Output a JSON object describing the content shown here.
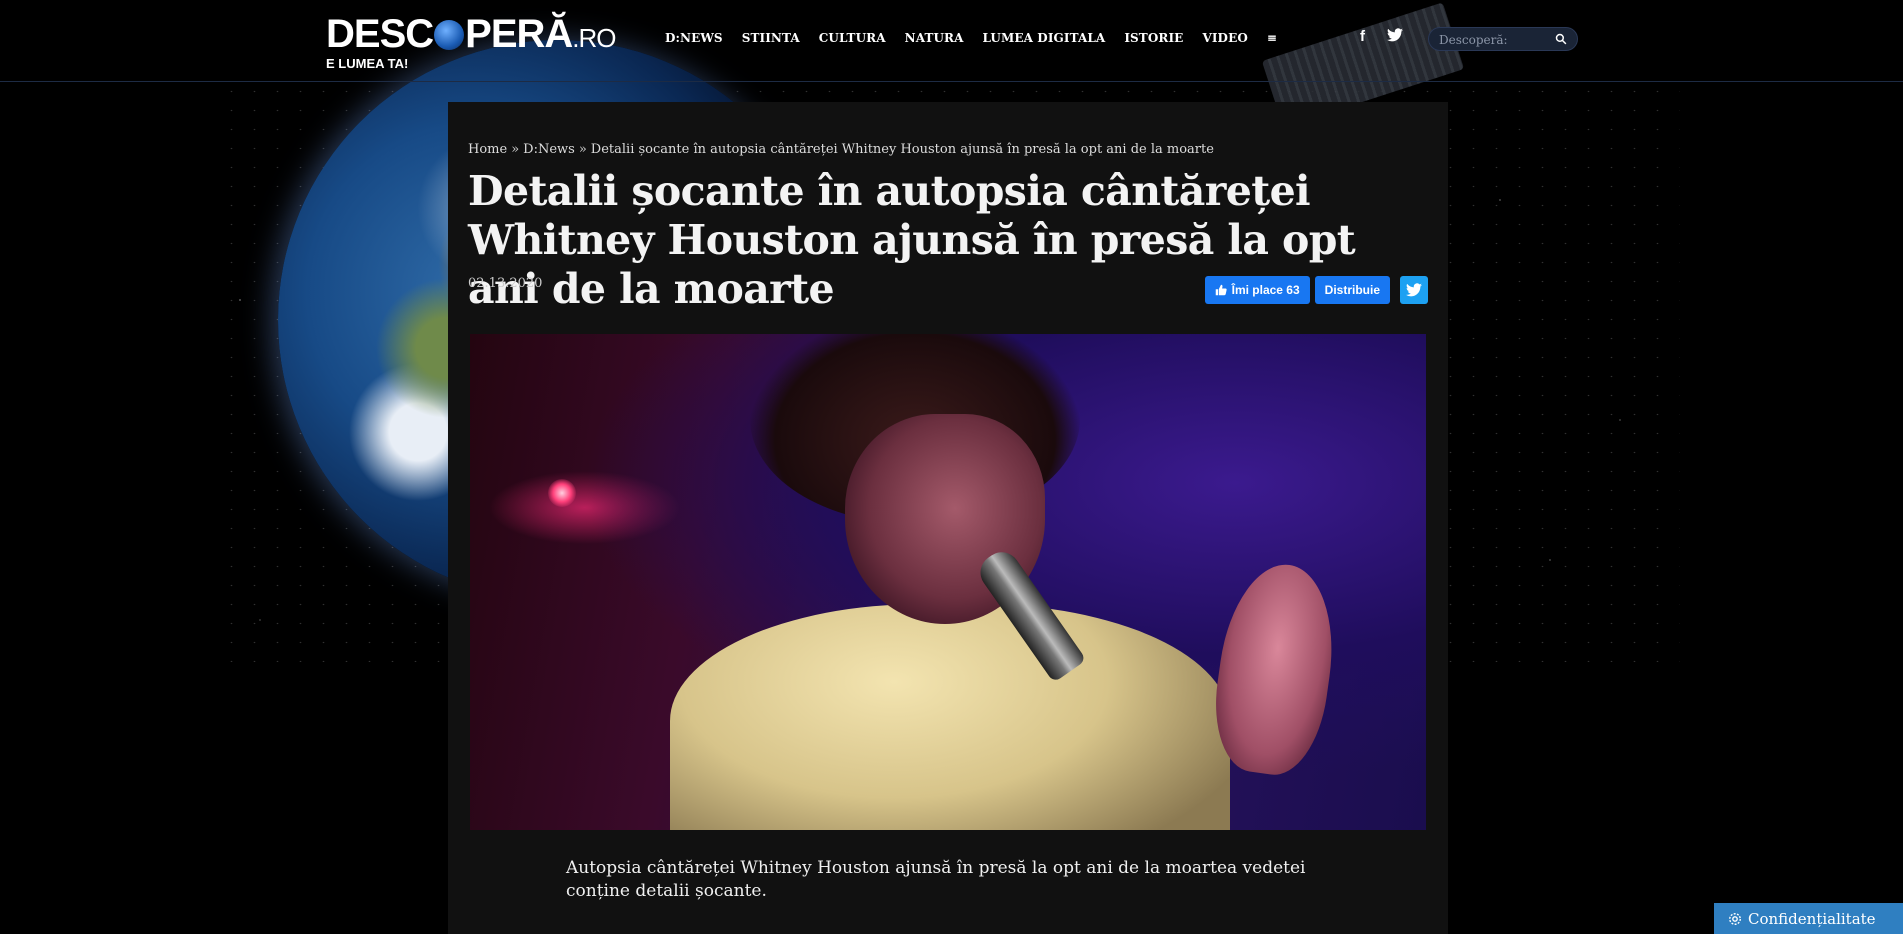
{
  "site": {
    "logo_main": "DESC",
    "logo_main_rest": "PERĂ",
    "logo_tld": ".RO",
    "logo_tagline": "E LUMEA TA!"
  },
  "nav": {
    "items": [
      "D:NEWS",
      "STIINTA",
      "CULTURA",
      "NATURA",
      "LUMEA DIGITALA",
      "ISTORIE",
      "VIDEO"
    ],
    "menu_icon": "≡"
  },
  "social": {
    "facebook_glyph": "f",
    "twitter_glyph": "t"
  },
  "search": {
    "placeholder": "Descoperă:"
  },
  "article": {
    "breadcrumb": {
      "home": "Home",
      "section": "D:News",
      "current": "Detalii șocante în autopsia cântăreței Whitney Houston ajunsă în presă la opt ani de la moarte",
      "separator": "»"
    },
    "title": "Detalii șocante în autopsia cântăreței Whitney Houston ajunsă în presă la opt ani de la moarte",
    "date": "02.13.2020",
    "share": {
      "like_label": "Îmi place 63",
      "share_label": "Distribuie"
    },
    "lead": "Autopsia cântăreței Whitney Houston ajunsă în presă la opt ani de la moartea vedetei conține detalii șocante."
  },
  "privacy": {
    "label": "Confidențialitate"
  },
  "colors": {
    "facebook": "#1877f2",
    "twitter": "#1da1f2",
    "privacy_button": "#2f7fc1",
    "card_bg": "#111111"
  }
}
